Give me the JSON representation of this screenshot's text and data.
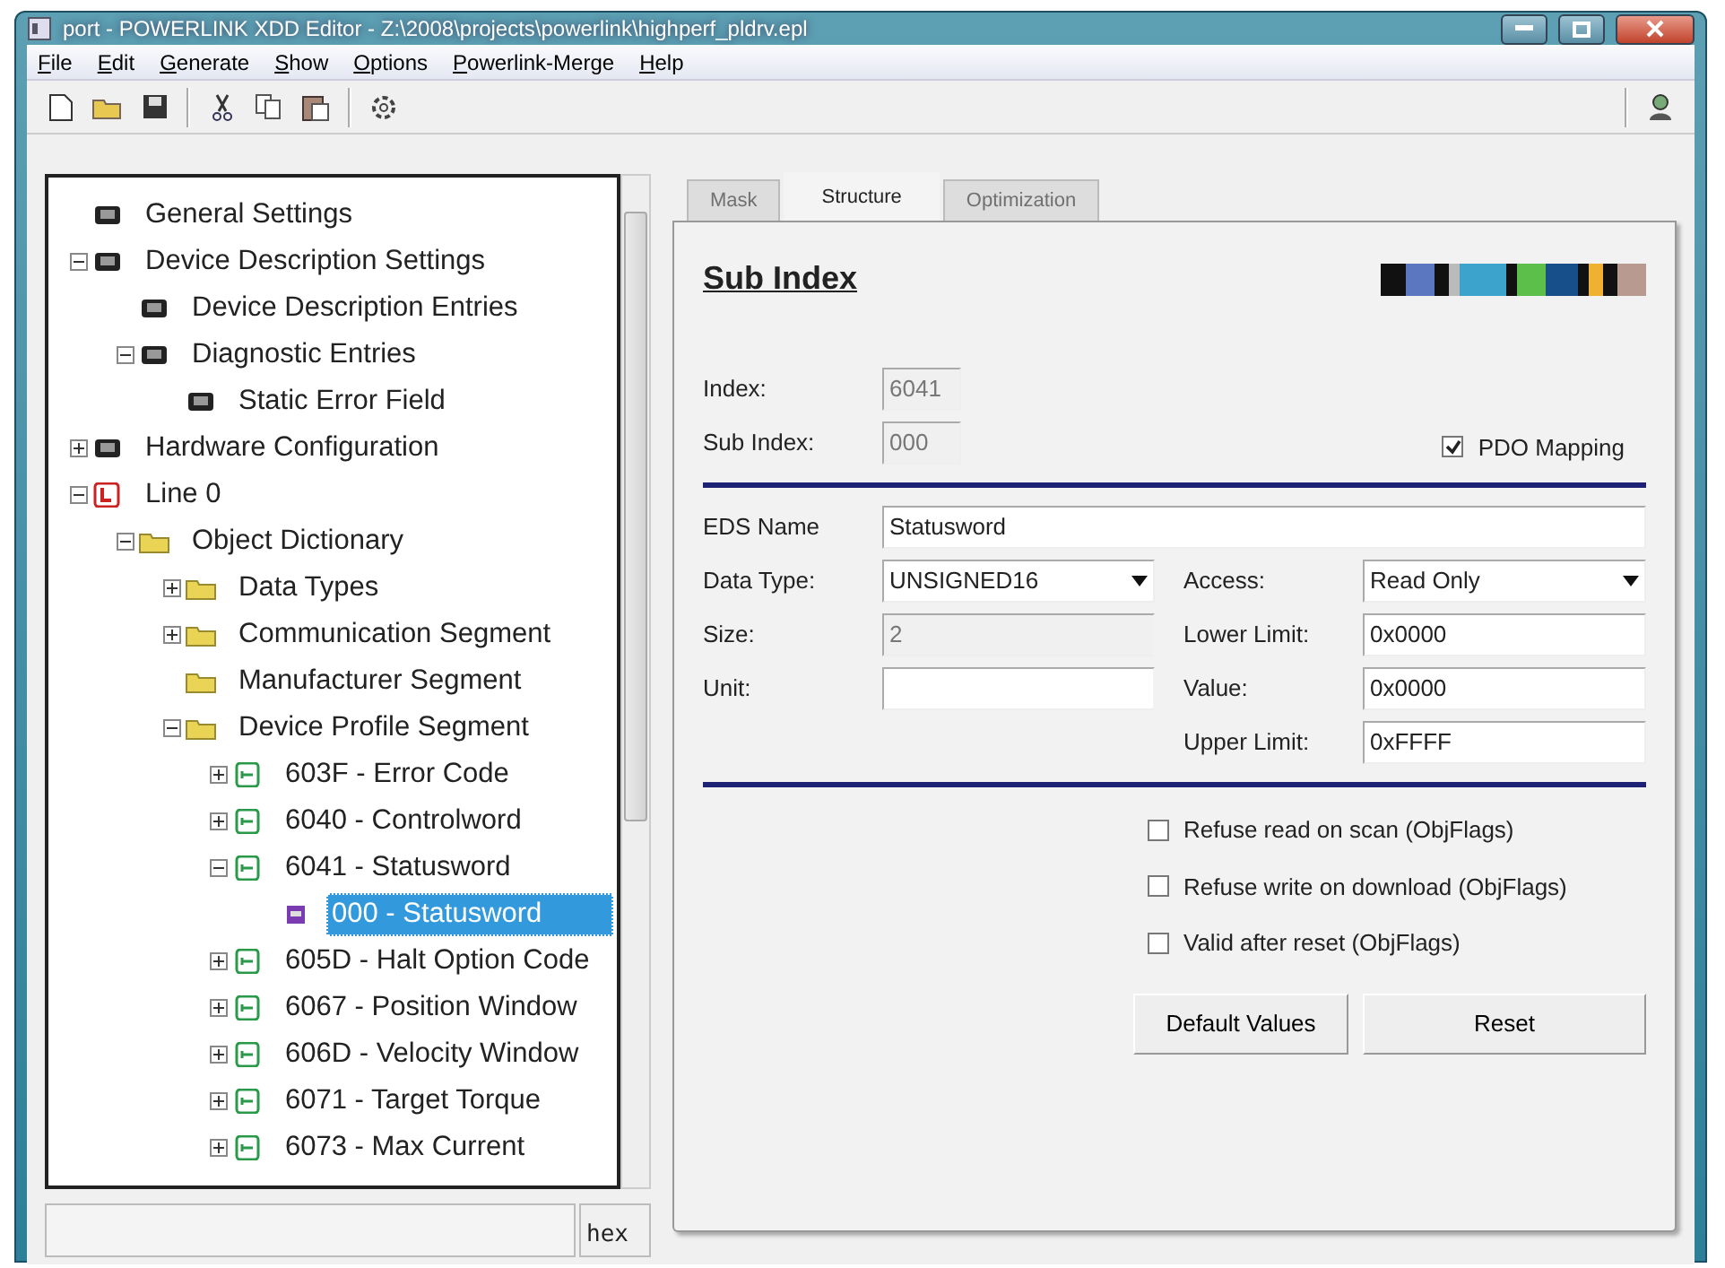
{
  "window": {
    "title": "port - POWERLINK XDD Editor - Z:\\2008\\projects\\powerlink\\highperf_pldrv.epl"
  },
  "menu": [
    "File",
    "Edit",
    "Generate",
    "Show",
    "Options",
    "Powerlink-Merge",
    "Help"
  ],
  "tree": [
    {
      "label": "General Settings",
      "kind": "device",
      "selected": false
    },
    {
      "label": "Device Description Settings",
      "kind": "device",
      "expanded": true,
      "selected": false,
      "children": [
        {
          "label": "Device Description Entries",
          "kind": "device",
          "selected": false
        },
        {
          "label": "Diagnostic Entries",
          "kind": "device",
          "expanded": true,
          "selected": false,
          "children": [
            {
              "label": "Static Error Field",
              "kind": "device",
              "selected": false
            }
          ]
        }
      ]
    },
    {
      "label": "Hardware Configuration",
      "kind": "device",
      "expanded": false,
      "selected": false
    },
    {
      "label": "Line 0",
      "kind": "line",
      "expanded": true,
      "selected": false,
      "children": [
        {
          "label": "Object Dictionary",
          "kind": "folder",
          "expanded": true,
          "selected": false,
          "children": [
            {
              "label": "Data Types",
              "kind": "folder",
              "expanded": false,
              "selected": false
            },
            {
              "label": "Communication Segment",
              "kind": "folder",
              "expanded": false,
              "selected": false
            },
            {
              "label": "Manufacturer Segment",
              "kind": "folder",
              "selected": false
            },
            {
              "label": "Device Profile Segment",
              "kind": "folder",
              "expanded": true,
              "selected": false,
              "children": [
                {
                  "label": "603F - Error Code",
                  "kind": "object",
                  "expanded": false,
                  "selected": false
                },
                {
                  "label": "6040 - Controlword",
                  "kind": "object",
                  "expanded": false,
                  "selected": false
                },
                {
                  "label": "6041 - Statusword",
                  "kind": "object",
                  "expanded": true,
                  "selected": false,
                  "children": [
                    {
                      "label": "000 - Statusword",
                      "kind": "subobject",
                      "selected": true
                    }
                  ]
                },
                {
                  "label": "605D - Halt Option Code",
                  "kind": "object",
                  "expanded": false,
                  "selected": false
                },
                {
                  "label": "6067 - Position Window",
                  "kind": "object",
                  "expanded": false,
                  "selected": false
                },
                {
                  "label": "606D - Velocity Window",
                  "kind": "object",
                  "expanded": false,
                  "selected": false
                },
                {
                  "label": "6071 - Target Torque",
                  "kind": "object",
                  "expanded": false,
                  "selected": false
                },
                {
                  "label": "6073 - Max Current",
                  "kind": "object",
                  "expanded": false,
                  "selected": false
                }
              ]
            }
          ]
        }
      ]
    }
  ],
  "tabs": [
    {
      "label": "Mask",
      "selected": false,
      "disabled": true
    },
    {
      "label": "Structure",
      "selected": true,
      "disabled": false
    },
    {
      "label": "Optimization",
      "selected": false,
      "disabled": true
    }
  ],
  "heading": "Sub Index",
  "identity": [
    {
      "label": "Index:",
      "value": "6041",
      "disabled": true
    },
    {
      "label": "Sub Index:",
      "value": "000",
      "disabled": true
    }
  ],
  "pdo_mapping": {
    "label": "PDO Mapping",
    "checked": true
  },
  "eds_name": {
    "label": "EDS Name",
    "value": "Statusword"
  },
  "left_fields": [
    {
      "label": "Data Type:",
      "kind": "select",
      "value": "UNSIGNED16",
      "disabled": false
    },
    {
      "label": "Size:",
      "kind": "text",
      "value": "2",
      "disabled": true
    },
    {
      "label": "Unit:",
      "kind": "text",
      "disabled": false
    }
  ],
  "right_fields": [
    {
      "label": "Access:",
      "kind": "select",
      "value": "Read Only",
      "disabled": false
    },
    {
      "label": "Lower Limit:",
      "kind": "text",
      "value": "0x0000",
      "disabled": false
    },
    {
      "label": "Value:",
      "kind": "text",
      "value": "0x0000",
      "disabled": false
    },
    {
      "label": "Upper Limit:",
      "kind": "text",
      "value": "0xFFFF",
      "disabled": false
    }
  ],
  "flags": [
    {
      "label": "Refuse read on scan (ObjFlags)",
      "checked": false
    },
    {
      "label": "Refuse write on download (ObjFlags)",
      "checked": false
    },
    {
      "label": "Valid after reset (ObjFlags)",
      "checked": false
    }
  ],
  "buttons": [
    "Default Values",
    "Reset"
  ],
  "status_bar": {
    "format": "hex"
  }
}
